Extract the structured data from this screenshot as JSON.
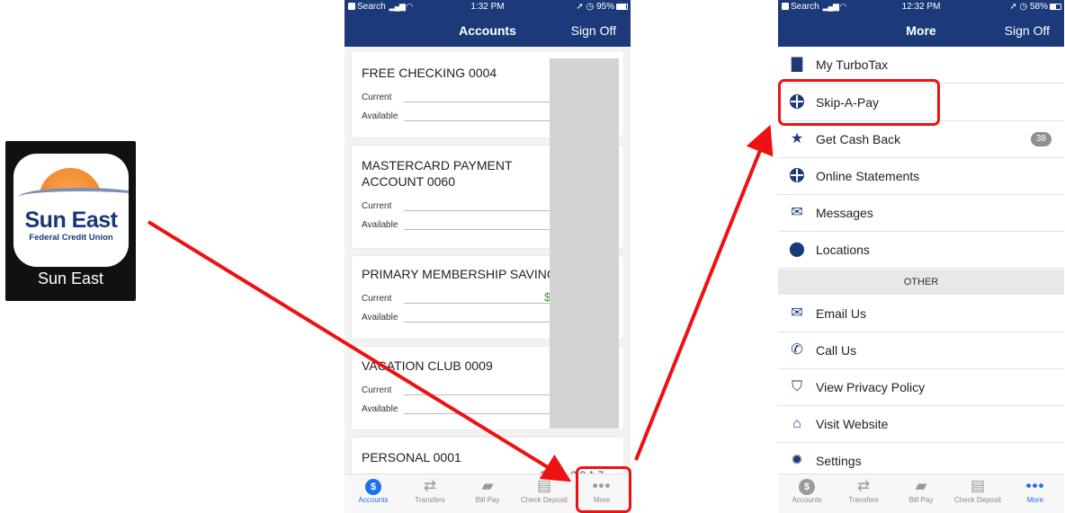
{
  "app_icon": {
    "brand_name": "Sun East",
    "brand_subtitle": "Federal Credit Union",
    "caption": "Sun East"
  },
  "phone1": {
    "status": {
      "carrier": "Search",
      "time": "1:32 PM",
      "battery": "95%",
      "battery_level": 0.95
    },
    "nav": {
      "title": "Accounts",
      "action": "Sign Off"
    },
    "accounts": [
      {
        "name": "FREE CHECKING 0004",
        "current_label": "Current",
        "available_label": "Available"
      },
      {
        "name": "MASTERCARD PAYMENT ACCOUNT 0060",
        "current_label": "Current",
        "available_label": "Available"
      },
      {
        "name": "PRIMARY MEMBERSHIP SAVING",
        "current_label": "Current",
        "available_label": "Available",
        "current_amount_partial": "$"
      },
      {
        "name": "VACATION CLUB 0009",
        "current_label": "Current",
        "available_label": "Available"
      },
      {
        "name": "PERSONAL 0001",
        "partial_amount": "$ 1 0 ,0 3 1 7"
      }
    ],
    "tabs": [
      {
        "label": "Accounts",
        "icon": "dollar-icon"
      },
      {
        "label": "Transfers",
        "icon": "transfer-arrows-icon"
      },
      {
        "label": "Bill Pay",
        "icon": "bill-pay-icon"
      },
      {
        "label": "Check Deposit",
        "icon": "check-deposit-icon"
      },
      {
        "label": "More",
        "icon": "more-dots-icon"
      }
    ]
  },
  "phone2": {
    "status": {
      "carrier": "Search",
      "time": "12:32 PM",
      "battery": "58%",
      "battery_level": 0.58
    },
    "nav": {
      "title": "More",
      "action": "Sign Off"
    },
    "menu": [
      {
        "label": "My TurboTax",
        "icon": "turbotax-folder-icon"
      },
      {
        "label": "Skip-A-Pay",
        "icon": "globe-icon"
      },
      {
        "label": "Get Cash Back",
        "icon": "star-icon",
        "badge": "38"
      },
      {
        "label": "Online Statements",
        "icon": "globe-icon"
      },
      {
        "label": "Messages",
        "icon": "envelope-icon"
      },
      {
        "label": "Locations",
        "icon": "map-pin-icon"
      }
    ],
    "section_other": "OTHER",
    "other_menu": [
      {
        "label": "Email Us",
        "icon": "envelope-icon"
      },
      {
        "label": "Call Us",
        "icon": "phone-icon"
      },
      {
        "label": "View Privacy Policy",
        "icon": "shield-icon"
      },
      {
        "label": "Visit Website",
        "icon": "website-icon"
      },
      {
        "label": "Settings",
        "icon": "gear-icon"
      }
    ],
    "tabs": [
      {
        "label": "Accounts",
        "icon": "dollar-icon"
      },
      {
        "label": "Transfers",
        "icon": "transfer-arrows-icon"
      },
      {
        "label": "Bill Pay",
        "icon": "bill-pay-icon"
      },
      {
        "label": "Check Deposit",
        "icon": "check-deposit-icon"
      },
      {
        "label": "More",
        "icon": "more-dots-icon"
      }
    ]
  },
  "colors": {
    "nav_blue": "#1c3a7a",
    "active_tab": "#1a73e8",
    "highlight_red": "#ee1111",
    "balance_green": "#3a9a2a"
  }
}
